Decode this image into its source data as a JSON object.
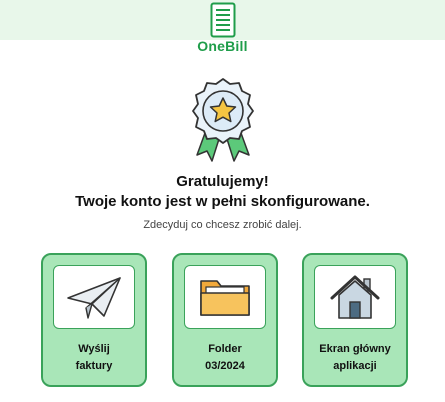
{
  "app": {
    "name": "OneBill"
  },
  "hero": {
    "title_line1": "Gratulujemy!",
    "title_line2": "Twoje konto jest w pełni skonfigurowane.",
    "subtitle": "Zdecyduj co chcesz zrobić dalej."
  },
  "actions": [
    {
      "line1": "Wyślij",
      "line2": "faktury",
      "icon": "paper-plane-icon"
    },
    {
      "line1": "Folder",
      "line2": "03/2024",
      "icon": "folder-icon"
    },
    {
      "line1": "Ekran główny",
      "line2": "aplikacji",
      "icon": "home-icon"
    }
  ],
  "colors": {
    "brand": "#1f9d4a",
    "card_bg": "#a9e6b8",
    "card_border": "#3aa25a",
    "top_band": "#e8f7ea"
  }
}
